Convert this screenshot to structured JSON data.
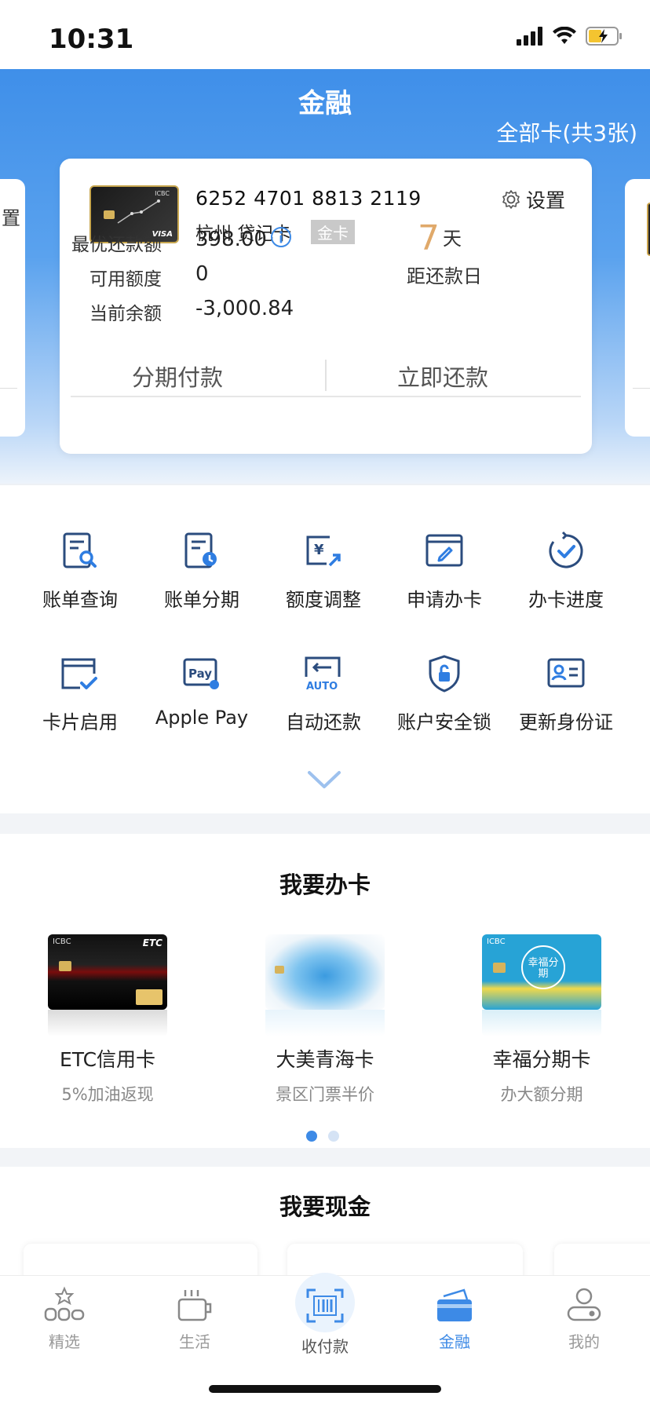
{
  "status_bar": {
    "time": "10:31"
  },
  "header": {
    "title": "金融",
    "all_cards": "全部卡(共3张)"
  },
  "peek_left": {
    "text": "置"
  },
  "card": {
    "number": "6252 4701 8813 2119",
    "name": "杭州 贷记卡",
    "badge": "金卡",
    "settings": "设置",
    "rows": [
      {
        "label": "最优还款额",
        "value": "398.00"
      },
      {
        "label": "可用额度",
        "value": "0"
      },
      {
        "label": "当前余额",
        "value": "-3,000.84"
      }
    ],
    "days_num": "7",
    "days_unit": "天",
    "days_label": "距还款日",
    "actions": [
      "分期付款",
      "立即还款"
    ],
    "thumb_brand": "ICBC",
    "thumb_network": "VISA"
  },
  "services": [
    {
      "label": "账单查询",
      "icon": "bill-search-icon"
    },
    {
      "label": "账单分期",
      "icon": "bill-installment-icon"
    },
    {
      "label": "额度调整",
      "icon": "limit-adjust-icon"
    },
    {
      "label": "申请办卡",
      "icon": "apply-card-icon"
    },
    {
      "label": "办卡进度",
      "icon": "progress-icon"
    },
    {
      "label": "卡片启用",
      "icon": "card-activate-icon"
    },
    {
      "label": "Apple Pay",
      "icon": "apple-pay-icon"
    },
    {
      "label": "自动还款",
      "icon": "auto-repay-icon"
    },
    {
      "label": "账户安全锁",
      "icon": "security-lock-icon"
    },
    {
      "label": "更新身份证",
      "icon": "id-card-icon"
    }
  ],
  "apply_section": {
    "title": "我要办卡",
    "cards": [
      {
        "name": "ETC信用卡",
        "sub": "5%加油返现",
        "card_text": "ETC"
      },
      {
        "name": "大美青海卡",
        "sub": "景区门票半价"
      },
      {
        "name": "幸福分期卡",
        "sub": "办大额分期",
        "card_text": "幸福分期"
      }
    ],
    "page_index": 0,
    "page_count": 2
  },
  "cash_section": {
    "title": "我要现金"
  },
  "tabs": [
    {
      "label": "精选",
      "icon": "featured-icon"
    },
    {
      "label": "生活",
      "icon": "life-icon"
    },
    {
      "label": "收付款",
      "icon": "scan-pay-icon"
    },
    {
      "label": "金融",
      "icon": "finance-card-icon",
      "active": true
    },
    {
      "label": "我的",
      "icon": "profile-icon"
    }
  ],
  "colors": {
    "accent": "#3d8ae6",
    "days": "#e0a96a",
    "icon_dark": "#2b4c7e"
  }
}
